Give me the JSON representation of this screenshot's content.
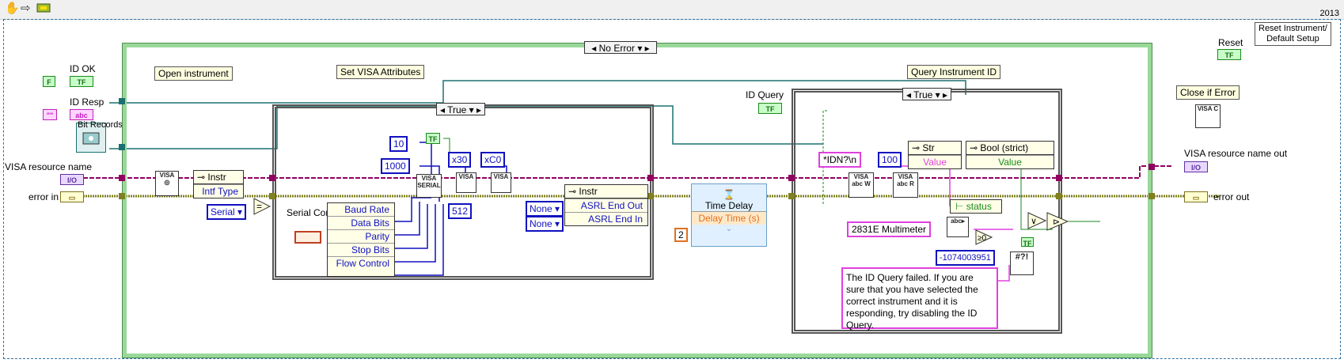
{
  "year": "2013",
  "toolbar": {
    "icons": [
      "hand-icon",
      "arrow-icon",
      "run-highlight-icon"
    ]
  },
  "labels": {
    "reset_default": "Reset Instrument/\nDefault Setup",
    "reset": "Reset",
    "id_ok": "ID OK",
    "id_resp": "ID Resp",
    "visa_resource_name": "VISA resource name",
    "error_in": "error in",
    "visa_resource_name_out": "VISA resource name out",
    "error_out": "error out",
    "close_if_error": "Close if Error",
    "id_query": "ID Query",
    "serial_config": "Serial Config",
    "open_instrument": "Open instrument",
    "set_visa_attributes": "Set VISA Attributes",
    "query_instrument_id": "Query Instrument ID",
    "overlap_text": "Bit Records"
  },
  "case_structures": {
    "outer": "No Error",
    "visa_attrs": "True",
    "query_id": "True"
  },
  "terminals": {
    "bool_tf": "TF",
    "bool_f": "F",
    "string_abc": "abc",
    "string_quote": "\"\"",
    "io": "I/O"
  },
  "constants": {
    "c10": "10",
    "c1000": "1000",
    "c512": "512",
    "hex30": "x30",
    "hexC0": "xC0",
    "serial": "Serial",
    "none1": "None",
    "none2": "None",
    "idn": "*IDN?\\n",
    "c100": "100",
    "multimeter": "2831E  Multimeter",
    "error_code": "-1074003951",
    "delay_2": "2",
    "comment": "The ID Query failed.  If you are sure that you have selected the correct instrument and it is responding, try disabling the ID Query."
  },
  "property_nodes": {
    "instr1": {
      "header": "Instr",
      "rows": [
        "Intf Type"
      ]
    },
    "instr2": {
      "header": "Instr",
      "rows": [
        "ASRL End Out",
        "ASRL End In"
      ]
    },
    "str": {
      "header": "Str",
      "rows": [
        "Value"
      ]
    },
    "bool": {
      "header": "Bool (strict)",
      "rows": [
        "Value"
      ]
    }
  },
  "serial_cluster": [
    "Baud Rate",
    "Data Bits",
    "Parity",
    "Stop Bits",
    "Flow Control"
  ],
  "time_delay": {
    "title": "Time Delay",
    "input": "Delay Time (s)"
  },
  "unbundle": {
    "status": "status"
  },
  "subvi_labels": {
    "visa_open": "VISA",
    "visa_serial": "VISA SERIAL",
    "visa_write": "VISA abc W",
    "visa_read": "VISA abc R",
    "visa_close": "VISA C",
    "visa_gen1": "VISA",
    "visa_gen2": "VISA"
  },
  "colors": {
    "case_border": "#9ad89a",
    "error_wire": "#808020",
    "visa_wire": "#900060",
    "refnum_wire": "#1a7070",
    "int_wire": "#1010c0",
    "string_wire": "#e040e0",
    "bool_wire": "#1a8a1a",
    "float_wire": "#e07020"
  }
}
